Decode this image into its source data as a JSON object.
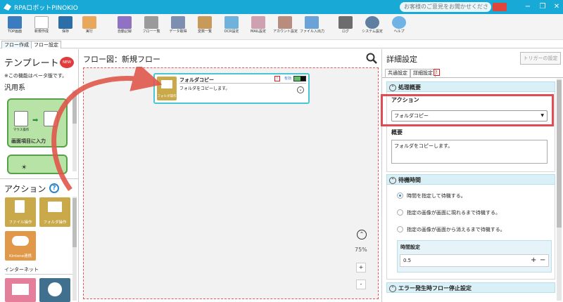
{
  "window": {
    "title": "RPAロボットPINOKIO",
    "feedback": "お客様のご意見をお聞かせください",
    "min": "−",
    "max": "❐",
    "close": "✕",
    "accent": "#18a9d6"
  },
  "toolbar": {
    "buttons": [
      {
        "label": "TOP画面",
        "icon": "home-icon",
        "color": "#3b7bbf"
      },
      {
        "label": "新規作成",
        "icon": "new-file-icon",
        "color": "#e8e8e8"
      },
      {
        "label": "保存",
        "icon": "save-icon",
        "color": "#2c6fa8"
      },
      {
        "label": "実行",
        "icon": "run-icon",
        "color": "#e9a75b"
      },
      {
        "label": "自動記録",
        "icon": "record-icon",
        "color": "#8f72c4"
      },
      {
        "label": "フロー一覧",
        "icon": "list-icon",
        "color": "#9a9a9a"
      },
      {
        "label": "データ取得",
        "icon": "database-icon",
        "color": "#7d8fb0"
      },
      {
        "label": "変数一覧",
        "icon": "box-icon",
        "color": "#c89a5a"
      },
      {
        "label": "OCR設定",
        "icon": "ocr-icon",
        "color": "#6fb2dc"
      },
      {
        "label": "MAIL設定",
        "icon": "mail-icon",
        "color": "#cfa0b0"
      },
      {
        "label": "アカウント設定",
        "icon": "account-icon",
        "color": "#b98d7e"
      },
      {
        "label": "ファイル入出力",
        "icon": "file-io-icon",
        "color": "#6aa3d8"
      },
      {
        "label": "ログ",
        "icon": "log-icon",
        "color": "#6d6d6d"
      },
      {
        "label": "システム設定",
        "icon": "gear-icon",
        "color": "#5f7ea0"
      },
      {
        "label": "ヘルプ",
        "icon": "help-icon",
        "color": "#6fb2e6"
      }
    ]
  },
  "tabs": {
    "flow_create": "フロー作成",
    "flow_settings": "フロー設定"
  },
  "left": {
    "template_title": "テンプレート",
    "new_badge": "NEW",
    "beta_note": "※この機能はベータ版です。",
    "category": "汎用系",
    "template_card_label": "画面項目に入力",
    "template_card_icon_text": "マウス操作",
    "action_title": "アクション",
    "help": "?",
    "actions": [
      {
        "label": "ファイル操作",
        "icon": "file-icon",
        "color": "#c9a94a"
      },
      {
        "label": "フォルダ操作",
        "icon": "folder-icon",
        "color": "#c9a94a"
      },
      {
        "label": "Kintone連携",
        "icon": "cloud-icon",
        "color": "#e19848"
      }
    ],
    "internet_label": "インターネット",
    "internet_icons": [
      {
        "icon": "mail-icon",
        "color": "#e47e9a"
      },
      {
        "icon": "globe-icon",
        "color": "#41708f"
      }
    ]
  },
  "canvas": {
    "title": "フロー図：新規フロー",
    "zoom": "75%",
    "zoom_in": "+",
    "zoom_out": "-",
    "node": {
      "name": "フォルダコピー",
      "desc": "フォルダをコピーします。",
      "icon_label": "フォルダ操作",
      "status": "有効",
      "warn": "!",
      "expand": "⌄"
    }
  },
  "right": {
    "title": "詳細設定",
    "trigger_btn": "トリガーの設定",
    "tab_common": "共通設定",
    "tab_detail": "詳細設定",
    "tab_warn": "!",
    "section_process": "処理概要",
    "action_label": "アクション",
    "action_value": "フォルダコピー",
    "summary_label": "概要",
    "summary_value": "フォルダをコピーします。",
    "section_wait": "待機時間",
    "wait_options": [
      {
        "label": "時間を指定して待機する。",
        "checked": true
      },
      {
        "label": "指定の画像が画面に現れるまで待機する。",
        "checked": false
      },
      {
        "label": "指定の画像が画面から消えるまで待機する。",
        "checked": false
      }
    ],
    "time_label": "時間設定",
    "time_value": "0.5",
    "plus": "+",
    "minus": "−",
    "section_error": "エラー発生時フロー停止設定",
    "highlight_color": "#e14b55"
  }
}
